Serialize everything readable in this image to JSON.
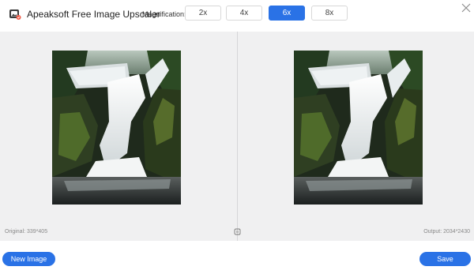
{
  "app": {
    "title": "Apeaksoft Free Image Upscaler",
    "logo_icon": "photo-logo-icon"
  },
  "magnification": {
    "label": "Magnification:",
    "options": [
      {
        "label": "2x",
        "selected": false
      },
      {
        "label": "4x",
        "selected": false
      },
      {
        "label": "6x",
        "selected": true
      },
      {
        "label": "8x",
        "selected": false
      }
    ]
  },
  "window": {
    "close_icon": "close-icon"
  },
  "preview": {
    "original_label": "Original: 339*405",
    "output_label": "Output: 2034*2430",
    "compare_icon": "compare-icon",
    "image_subject": "waterfall photo"
  },
  "actions": {
    "new_image_label": "New Image",
    "save_label": "Save"
  },
  "colors": {
    "accent": "#2a72e6",
    "panel_bg": "#f0f0f1",
    "divider": "#d6d6d8"
  }
}
